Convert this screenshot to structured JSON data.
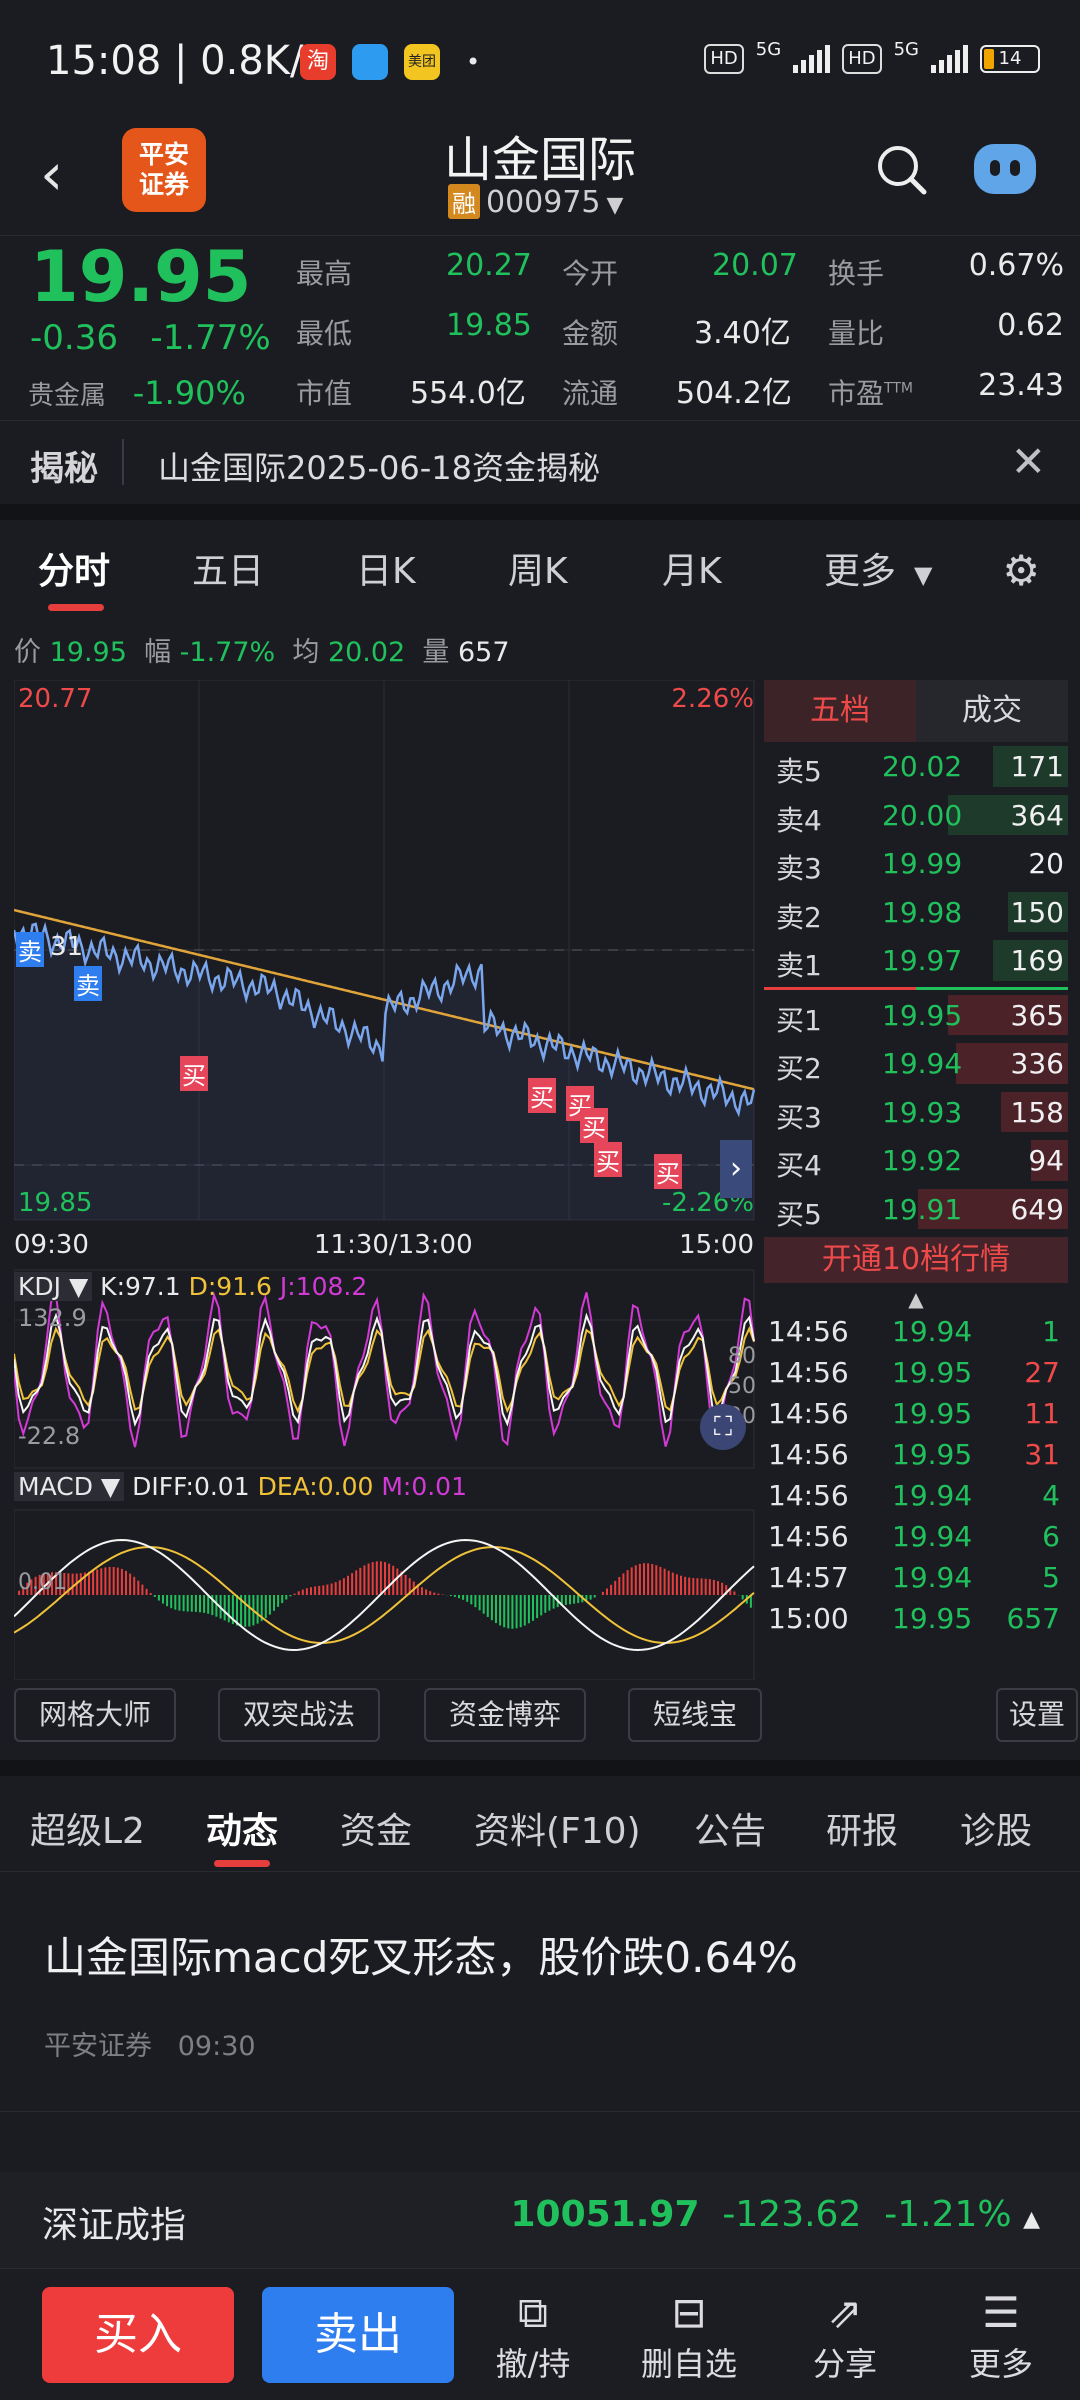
{
  "status": {
    "time": "15:08 | 0.8K/s",
    "battery": "14",
    "net1": "5G",
    "net2": "5G",
    "hd": "HD",
    "app_badge1": "淘",
    "app_badge3": "美团"
  },
  "header": {
    "title": "山金国际",
    "rong": "融",
    "code": "000975",
    "logo_line1": "平安",
    "logo_line2": "证券"
  },
  "quote": {
    "price": "19.95",
    "change": "-0.36",
    "change_pct": "-1.77%",
    "sector": "贵金属",
    "sector_pct": "-1.90%",
    "high_label": "最高",
    "high": "20.27",
    "open_label": "今开",
    "open": "20.07",
    "turnover_label": "换手",
    "turnover": "0.67%",
    "low_label": "最低",
    "low": "19.85",
    "amount_label": "金额",
    "amount": "3.40亿",
    "volratio_label": "量比",
    "volratio": "0.62",
    "mcap_label": "市值",
    "mcap": "554.0亿",
    "float_label": "流通",
    "float": "504.2亿",
    "pe_label": "市盈",
    "pe_sup": "TTM",
    "pe": "23.43"
  },
  "reveal": {
    "label": "揭秘",
    "text": "山金国际2025-06-18资金揭秘"
  },
  "ktabs": [
    "分时",
    "五日",
    "日K",
    "周K",
    "月K",
    "更多"
  ],
  "infoline": {
    "price_label": "价",
    "price": "19.95",
    "amp_label": "幅",
    "amp": "-1.77%",
    "avg_label": "均",
    "avg": "20.02",
    "vol_label": "量",
    "vol": "657"
  },
  "chart_data": {
    "type": "line",
    "price_top": "20.77",
    "price_bottom": "19.85",
    "pct_top": "2.26%",
    "pct_bottom": "-2.26%",
    "ref_marker": "31",
    "x_labels": [
      "09:30",
      "11:30/13:00",
      "15:00"
    ],
    "signals": [
      {
        "type": "卖"
      },
      {
        "type": "卖"
      },
      {
        "type": "买"
      },
      {
        "type": "买"
      },
      {
        "type": "买"
      },
      {
        "type": "买"
      },
      {
        "type": "买"
      },
      {
        "type": "买"
      }
    ],
    "kdj": {
      "label": "KDJ",
      "k": "K:97.1",
      "d": "D:91.6",
      "j": "J:108.2",
      "top": "132.9",
      "bottom": "-22.8",
      "r80": "80",
      "r50": "50",
      "r20": "20"
    },
    "macd": {
      "label": "MACD",
      "diff": "DIFF:0.01",
      "dea": "DEA:0.00",
      "m": "M:0.01",
      "tick": "0.01"
    }
  },
  "book": {
    "tab_active": "五档",
    "tab_other": "成交",
    "asks": [
      {
        "label": "卖5",
        "price": "20.02",
        "vol": "171",
        "frac": 0.5
      },
      {
        "label": "卖4",
        "price": "20.00",
        "vol": "364",
        "frac": 0.8
      },
      {
        "label": "卖3",
        "price": "19.99",
        "vol": "20",
        "frac": 0.0
      },
      {
        "label": "卖2",
        "price": "19.98",
        "vol": "150",
        "frac": 0.4
      },
      {
        "label": "卖1",
        "price": "19.97",
        "vol": "169",
        "frac": 0.5
      }
    ],
    "bids": [
      {
        "label": "买1",
        "price": "19.95",
        "vol": "365",
        "frac": 0.8
      },
      {
        "label": "买2",
        "price": "19.94",
        "vol": "336",
        "frac": 0.75
      },
      {
        "label": "买3",
        "price": "19.93",
        "vol": "158",
        "frac": 0.45
      },
      {
        "label": "买4",
        "price": "19.92",
        "vol": "94",
        "frac": 0.25
      },
      {
        "label": "买5",
        "price": "19.91",
        "vol": "649",
        "frac": 1.0
      }
    ],
    "open10": "开通10档行情",
    "trades": [
      {
        "t": "14:56",
        "p": "19.94",
        "v": "1",
        "up": false
      },
      {
        "t": "14:56",
        "p": "19.95",
        "v": "27",
        "up": true
      },
      {
        "t": "14:56",
        "p": "19.95",
        "v": "11",
        "up": true
      },
      {
        "t": "14:56",
        "p": "19.95",
        "v": "31",
        "up": true
      },
      {
        "t": "14:56",
        "p": "19.94",
        "v": "4",
        "up": false
      },
      {
        "t": "14:56",
        "p": "19.94",
        "v": "6",
        "up": false
      },
      {
        "t": "14:57",
        "p": "19.94",
        "v": "5",
        "up": false
      },
      {
        "t": "15:00",
        "p": "19.95",
        "v": "657",
        "up": false
      }
    ]
  },
  "tools": [
    "网格大师",
    "双突战法",
    "资金博弈",
    "短线宝",
    "设置"
  ],
  "btabs": [
    "超级L2",
    "动态",
    "资金",
    "资料(F10)",
    "公告",
    "研报",
    "诊股"
  ],
  "news": {
    "headline": "山金国际macd死叉形态，股价跌0.64%",
    "source": "平安证券",
    "time": "09:30"
  },
  "index": {
    "name": "深证成指",
    "value": "10051.97",
    "change": "-123.62",
    "pct": "-1.21%"
  },
  "bottom": {
    "buy": "买入",
    "sell": "卖出",
    "chijia": "撤/持",
    "remove": "删自选",
    "share": "分享",
    "more": "更多"
  },
  "colors": {
    "green": "#20c15c",
    "red": "#ef4a4a",
    "price_line": "#7aa6ee",
    "avg_line": "#e0a43a",
    "kdj_j": "#d23ad6",
    "kdj_d": "#f0c23a",
    "blue": "#2f7ef0"
  }
}
